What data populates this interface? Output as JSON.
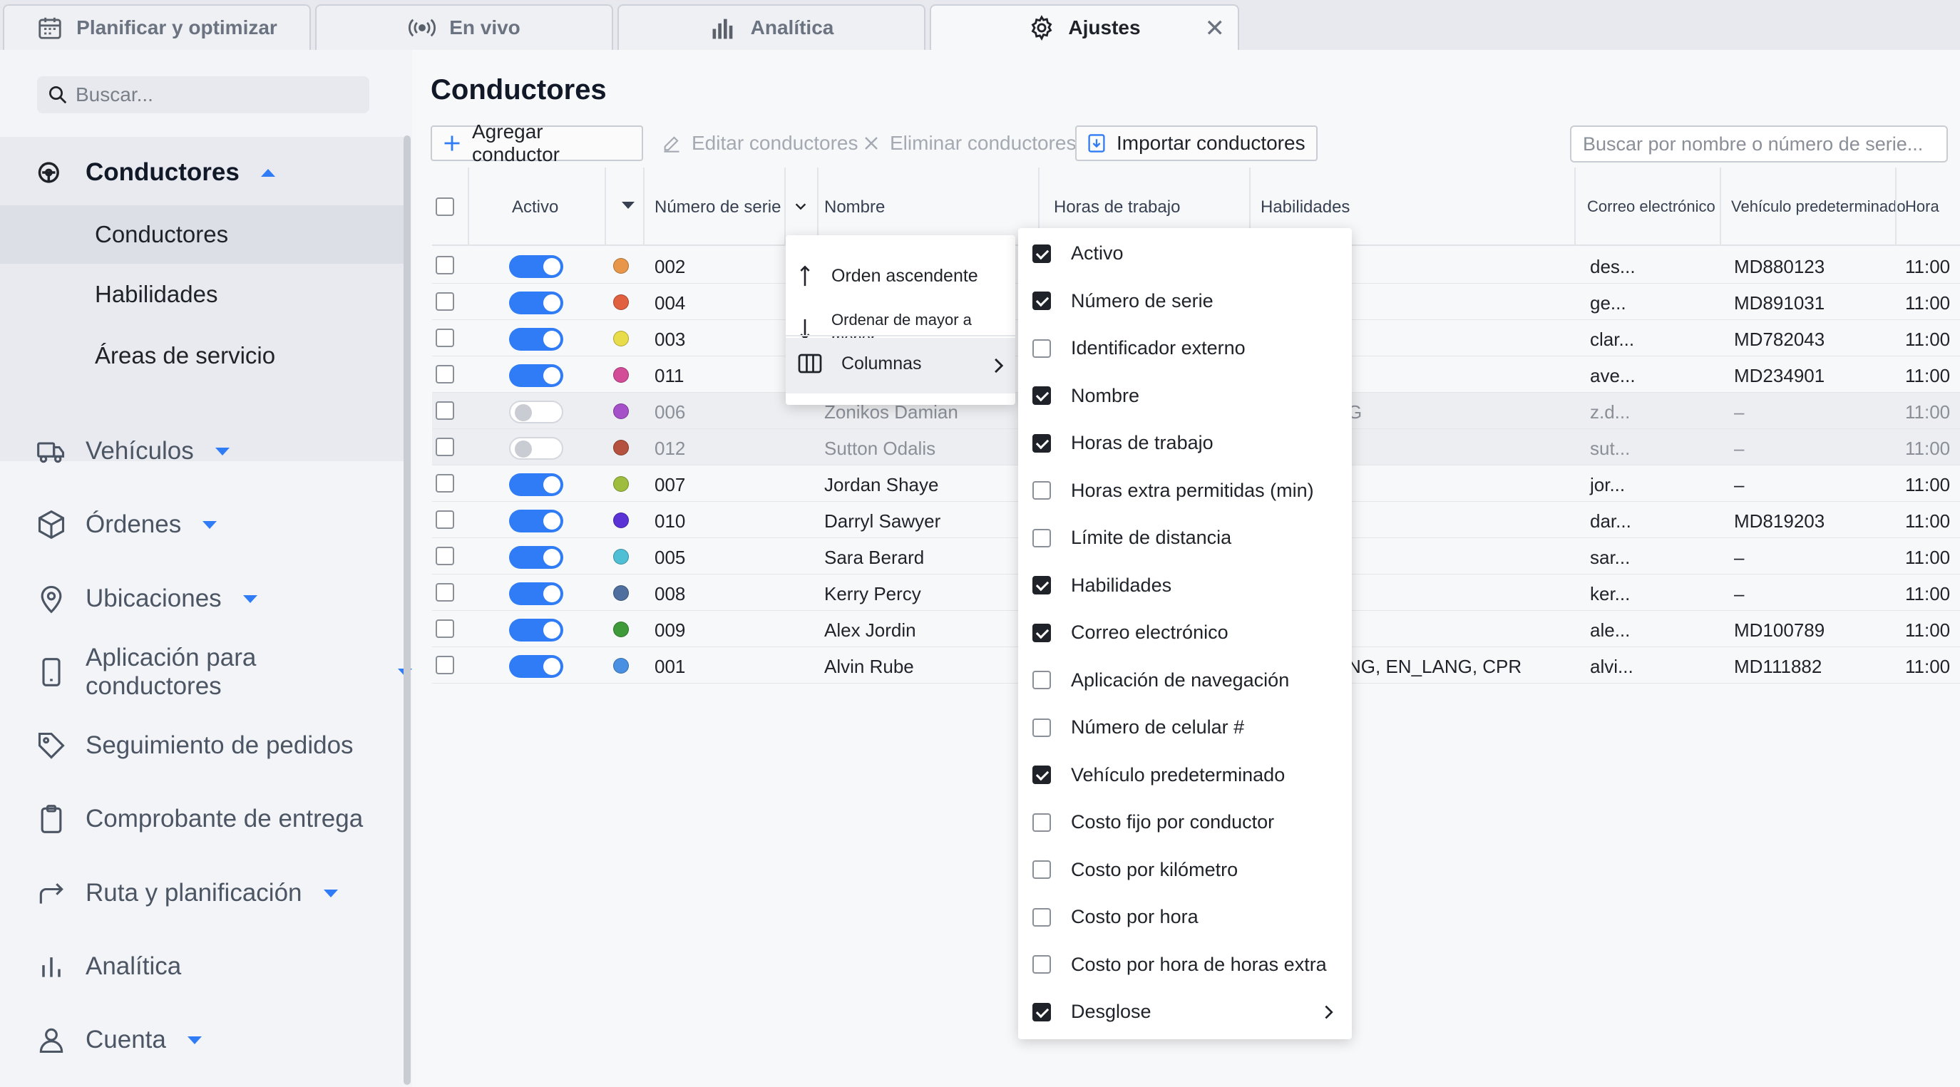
{
  "tabs": [
    {
      "label": "Planificar y optimizar",
      "icon": "calendar-icon"
    },
    {
      "label": "En vivo",
      "icon": "broadcast-icon"
    },
    {
      "label": "Analítica",
      "icon": "bar-chart-icon"
    },
    {
      "label": "Ajustes",
      "icon": "gear-icon",
      "active": true
    }
  ],
  "sidebar": {
    "search_placeholder": "Buscar...",
    "drivers": "Conductores",
    "sub": [
      "Conductores",
      "Habilidades",
      "Áreas de servicio"
    ],
    "items": [
      {
        "label": "Vehículos",
        "icon": "truck-icon"
      },
      {
        "label": "Órdenes",
        "icon": "package-icon"
      },
      {
        "label": "Ubicaciones",
        "icon": "location-pin-icon"
      },
      {
        "label": "Aplicación para conductores",
        "icon": "mobile-icon"
      },
      {
        "label": "Seguimiento de pedidos",
        "icon": "tag-icon"
      },
      {
        "label": "Comprobante de entrega",
        "icon": "clipboard-icon"
      },
      {
        "label": "Ruta y planificación",
        "icon": "route-icon"
      },
      {
        "label": "Analítica",
        "icon": "analytics-icon"
      },
      {
        "label": "Cuenta",
        "icon": "user-icon"
      }
    ]
  },
  "main": {
    "title": "Conductores",
    "toolbar": {
      "add": "Agregar conductor",
      "edit": "Editar conductores",
      "delete": "Eliminar conductores",
      "import": "Importar conductores",
      "search_placeholder": "Buscar por nombre o número de serie..."
    },
    "headers": {
      "active": "Activo",
      "serial": "Número de serie",
      "name": "Nombre",
      "hours": "Horas de trabajo",
      "skills": "Habilidades",
      "email": "Correo electrónico",
      "vehicle": "Vehículo predeterminado",
      "hora": "Hora"
    },
    "rows": [
      {
        "active": true,
        "color": "#e8974a",
        "serial": "002",
        "name": "",
        "skills": "",
        "email": "des...",
        "vehicle": "MD880123",
        "hora": "11:00"
      },
      {
        "active": true,
        "color": "#e0603f",
        "serial": "004",
        "name": "",
        "skills": "",
        "email": "ge...",
        "vehicle": "MD891031",
        "hora": "11:00"
      },
      {
        "active": true,
        "color": "#e9dc4a",
        "serial": "003",
        "name": "",
        "skills": "",
        "email": "clar...",
        "vehicle": "MD782043",
        "hora": "11:00"
      },
      {
        "active": true,
        "color": "#d24c97",
        "serial": "011",
        "name": "",
        "skills": "",
        "email": "ave...",
        "vehicle": "MD234901",
        "hora": "11:00"
      },
      {
        "active": false,
        "color": "#a54fc8",
        "serial": "006",
        "name": "Zonikos Damian",
        "skills": "G",
        "email": "z.d...",
        "vehicle": "–",
        "hora": "11:00"
      },
      {
        "active": false,
        "color": "#b5523f",
        "serial": "012",
        "name": "Sutton Odalis",
        "skills": "",
        "email": "sut...",
        "vehicle": "–",
        "hora": "11:00"
      },
      {
        "active": true,
        "color": "#9ebd3e",
        "serial": "007",
        "name": "Jordan Shaye",
        "skills": "",
        "email": "jor...",
        "vehicle": "–",
        "hora": "11:00"
      },
      {
        "active": true,
        "color": "#5a32d6",
        "serial": "010",
        "name": "Darryl Sawyer",
        "skills": "",
        "email": "dar...",
        "vehicle": "MD819203",
        "hora": "11:00"
      },
      {
        "active": true,
        "color": "#4fbfd6",
        "serial": "005",
        "name": "Sara Berard",
        "skills": "",
        "email": "sar...",
        "vehicle": "–",
        "hora": "11:00"
      },
      {
        "active": true,
        "color": "#4f6f9e",
        "serial": "008",
        "name": "Kerry Percy",
        "skills": "",
        "email": "ker...",
        "vehicle": "–",
        "hora": "11:00"
      },
      {
        "active": true,
        "color": "#3f9a3a",
        "serial": "009",
        "name": "Alex Jordin",
        "skills": "",
        "email": "ale...",
        "vehicle": "MD100789",
        "hora": "11:00"
      },
      {
        "active": true,
        "color": "#4a90e2",
        "serial": "001",
        "name": "Alvin Rube",
        "skills": "NG, EN_LANG, CPR",
        "email": "alvi...",
        "vehicle": "MD111882",
        "hora": "11:00"
      }
    ]
  },
  "context_menu": {
    "asc": "Orden ascendente",
    "desc": "Ordenar de mayor a menor",
    "columns": "Columnas"
  },
  "columns_menu": [
    {
      "label": "Activo",
      "checked": true
    },
    {
      "label": "Número de serie",
      "checked": true
    },
    {
      "label": "Identificador externo",
      "checked": false
    },
    {
      "label": "Nombre",
      "checked": true
    },
    {
      "label": "Horas de trabajo",
      "checked": true
    },
    {
      "label": "Horas extra permitidas (min)",
      "checked": false
    },
    {
      "label": "Límite de distancia",
      "checked": false
    },
    {
      "label": "Habilidades",
      "checked": true
    },
    {
      "label": "Correo electrónico",
      "checked": true
    },
    {
      "label": "Aplicación de navegación",
      "checked": false
    },
    {
      "label": "Número de celular #",
      "checked": false
    },
    {
      "label": "Vehículo predeterminado",
      "checked": true
    },
    {
      "label": "Costo fijo por conductor",
      "checked": false
    },
    {
      "label": "Costo por kilómetro",
      "checked": false
    },
    {
      "label": "Costo por hora",
      "checked": false
    },
    {
      "label": "Costo por hora de horas extra",
      "checked": false
    },
    {
      "label": "Desglose",
      "checked": true,
      "submenu": true
    }
  ]
}
